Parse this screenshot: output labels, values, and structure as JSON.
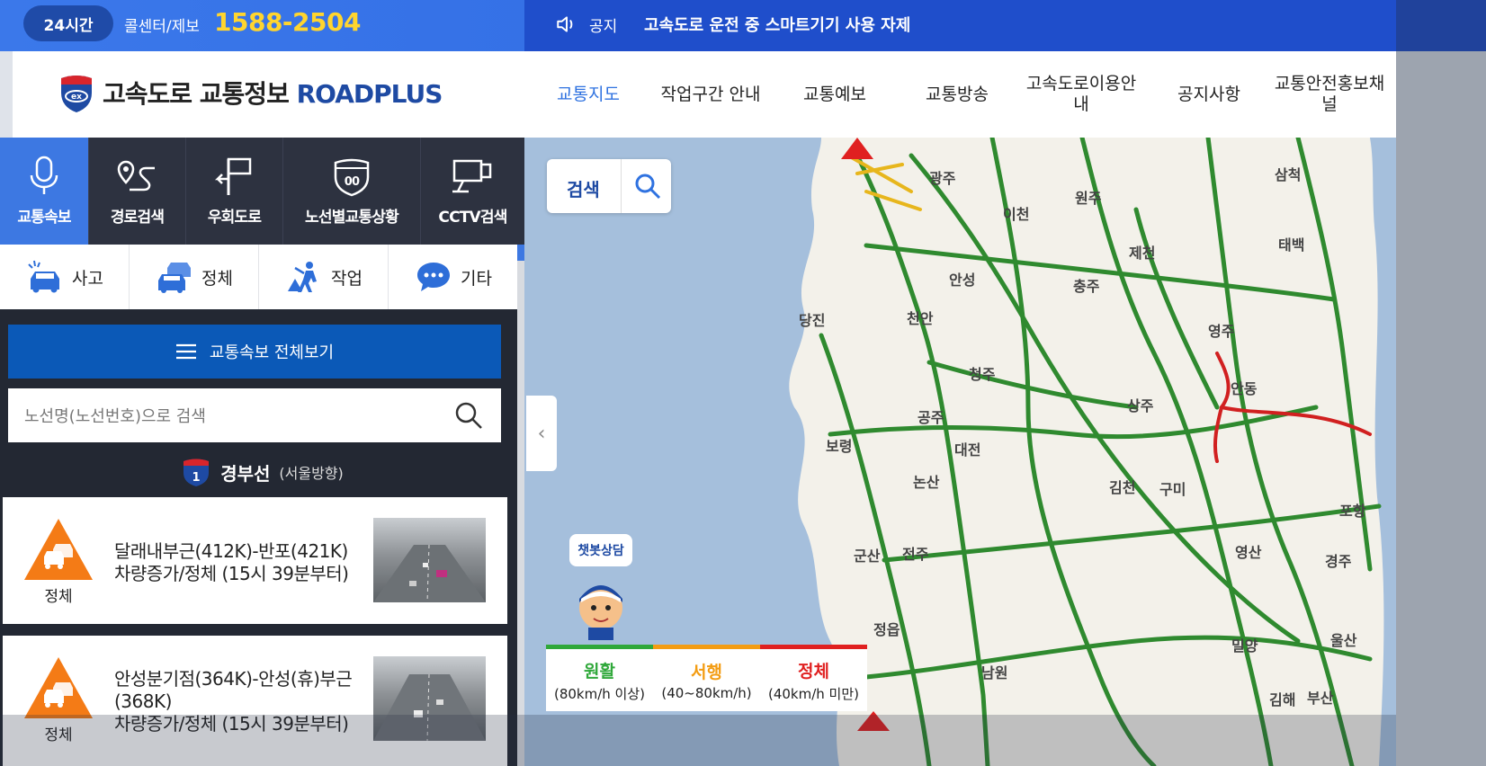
{
  "topbar": {
    "hours_badge": "24시간",
    "callcenter_label": "콜센터/제보",
    "phone": "1588-2504",
    "notice_label": "공지",
    "notice_text": "고속도로 운전 중 스마트기기 사용 자제"
  },
  "header": {
    "logo_text": "고속도로 교통정보",
    "logo_brand": "ROADPLUS",
    "nav": [
      "교통지도",
      "작업구간 안내",
      "교통예보",
      "교통방송",
      "고속도로이용안내",
      "공지사항",
      "교통안전홍보채널"
    ]
  },
  "tools": [
    {
      "label": "교통속보",
      "icon": "microphone-icon"
    },
    {
      "label": "경로검색",
      "icon": "route-icon"
    },
    {
      "label": "우회도로",
      "icon": "detour-icon"
    },
    {
      "label": "노선별교통상황",
      "icon": "route-shield-icon"
    },
    {
      "label": "CCTV검색",
      "icon": "cctv-icon"
    }
  ],
  "categories": [
    {
      "label": "사고",
      "icon": "accident-car-icon"
    },
    {
      "label": "정체",
      "icon": "congestion-cars-icon"
    },
    {
      "label": "작업",
      "icon": "roadwork-icon"
    },
    {
      "label": "기타",
      "icon": "speech-bubble-icon"
    }
  ],
  "viewall_label": "교통속보 전체보기",
  "search_placeholder": "노선명(노선번호)으로 검색",
  "route": {
    "number": "1",
    "name": "경부선",
    "direction": "(서울방향)"
  },
  "incidents": [
    {
      "type": "정체",
      "line1": "달래내부근(412K)-반포(421K)",
      "line2": "차량증가/정체 (15시 39분부터)"
    },
    {
      "type": "정체",
      "line1": "안성분기점(364K)-안성(휴)부근(368K)",
      "line2": "차량증가/정체 (15시 39분부터)"
    }
  ],
  "map": {
    "search_label": "검색",
    "chatbot_label": "챗봇상담",
    "places": [
      "광주",
      "이천",
      "원주",
      "제천",
      "삼척",
      "태백",
      "안성",
      "충주",
      "당진",
      "천안",
      "영주",
      "청주",
      "안동",
      "상주",
      "공주",
      "보령",
      "대전",
      "논산",
      "김천",
      "구미",
      "포항",
      "군산",
      "전주",
      "영산",
      "경주",
      "정읍",
      "밀양",
      "울산",
      "남원",
      "김해",
      "부산"
    ],
    "legend": [
      {
        "name": "원활",
        "speed": "(80km/h 이상)",
        "color": "#2fa83a"
      },
      {
        "name": "서행",
        "speed": "(40~80km/h)",
        "color": "#f39c12"
      },
      {
        "name": "정체",
        "speed": "(40km/h 미만)",
        "color": "#e02020"
      }
    ]
  }
}
